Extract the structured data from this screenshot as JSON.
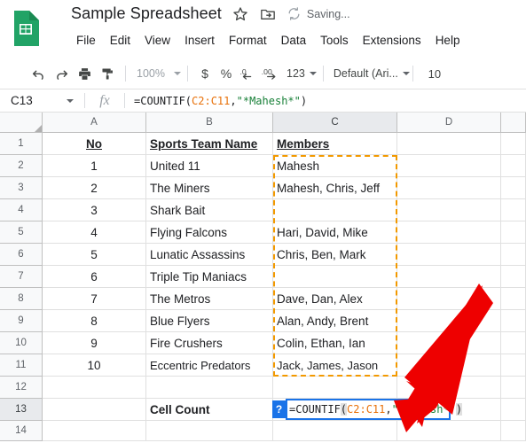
{
  "header": {
    "logo_icon": "google-sheets-logo",
    "doc_title": "Sample Spreadsheet",
    "star_icon": "star-icon",
    "move_folder_icon": "move-to-folder-icon",
    "sync_icon": "sync-icon",
    "save_state": "Saving...",
    "menu_items": [
      "File",
      "Edit",
      "View",
      "Insert",
      "Format",
      "Data",
      "Tools",
      "Extensions",
      "Help"
    ]
  },
  "toolbar": {
    "undo_icon": "undo-icon",
    "redo_icon": "redo-icon",
    "print_icon": "print-icon",
    "paint_format_icon": "paint-format-icon",
    "zoom_value": "100%",
    "currency_label": "$",
    "percent_label": "%",
    "decrease_decimal_label": ".0",
    "increase_decimal_label": ".00",
    "number_format_label": "123",
    "font_name": "Default (Ari...",
    "font_size": "10"
  },
  "formula_bar": {
    "name_box": "C13",
    "fx_icon": "fx-icon",
    "formula_prefix": "=COUNTIF(",
    "formula_range": "C2:C11",
    "formula_comma": ",",
    "formula_criteria": "\"*Mahesh*\"",
    "formula_suffix": ")"
  },
  "grid": {
    "columns": [
      "A",
      "B",
      "C",
      "D"
    ],
    "selected_column": "C",
    "selected_row": "13",
    "rows": [
      "1",
      "2",
      "3",
      "4",
      "5",
      "6",
      "7",
      "8",
      "9",
      "10",
      "11",
      "12",
      "13",
      "14"
    ],
    "cells": {
      "A1": "No",
      "B1": "Sports Team Name",
      "C1": "Members",
      "A2": "1",
      "B2": "United 11",
      "C2": "Mahesh",
      "A3": "2",
      "B3": "The Miners",
      "C3": "Mahesh, Chris, Jeff",
      "A4": "3",
      "B4": "Shark Bait",
      "C4": "",
      "A5": "4",
      "B5": "Flying Falcons",
      "C5": "Hari, David, Mike",
      "A6": "5",
      "B6": "Lunatic Assassins",
      "C6": "Chris, Ben, Mark",
      "A7": "6",
      "B7": "Triple Tip Maniacs",
      "C7": "",
      "A8": "7",
      "B8": "The Metros",
      "C8": "Dave, Dan, Alex",
      "A9": "8",
      "B9": "Blue Flyers",
      "C9": "Alan, Andy, Brent",
      "A10": "9",
      "B10": "Fire Crushers",
      "C10": "Colin, Ethan, Ian",
      "A11": "10",
      "B11": "Eccentric Predators",
      "C11": "Jack, James, Jason",
      "A12": "",
      "B12": "",
      "C12": "",
      "A13": "",
      "B13": "Cell Count",
      "C13": "",
      "A14": "",
      "B14": "",
      "C14": ""
    },
    "copied_range": "C2:C11",
    "active_cell": "C13"
  },
  "cell_editor": {
    "help_badge": "?",
    "prefix": "=COUNTIF",
    "open_paren": "(",
    "range": "C2:C11",
    "comma": ",",
    "criteria": "\"*Mahesh*\"",
    "close_paren": ")"
  },
  "annotation": {
    "arrow_icon": "red-arrow-pointing-down-left",
    "arrow_color": "#ee0000"
  },
  "colors": {
    "brand_green": "#21a366",
    "accent_blue": "#1a73e8",
    "marching_ants": "#f29900",
    "formula_ref": "#e8710a",
    "formula_string": "#188038"
  }
}
